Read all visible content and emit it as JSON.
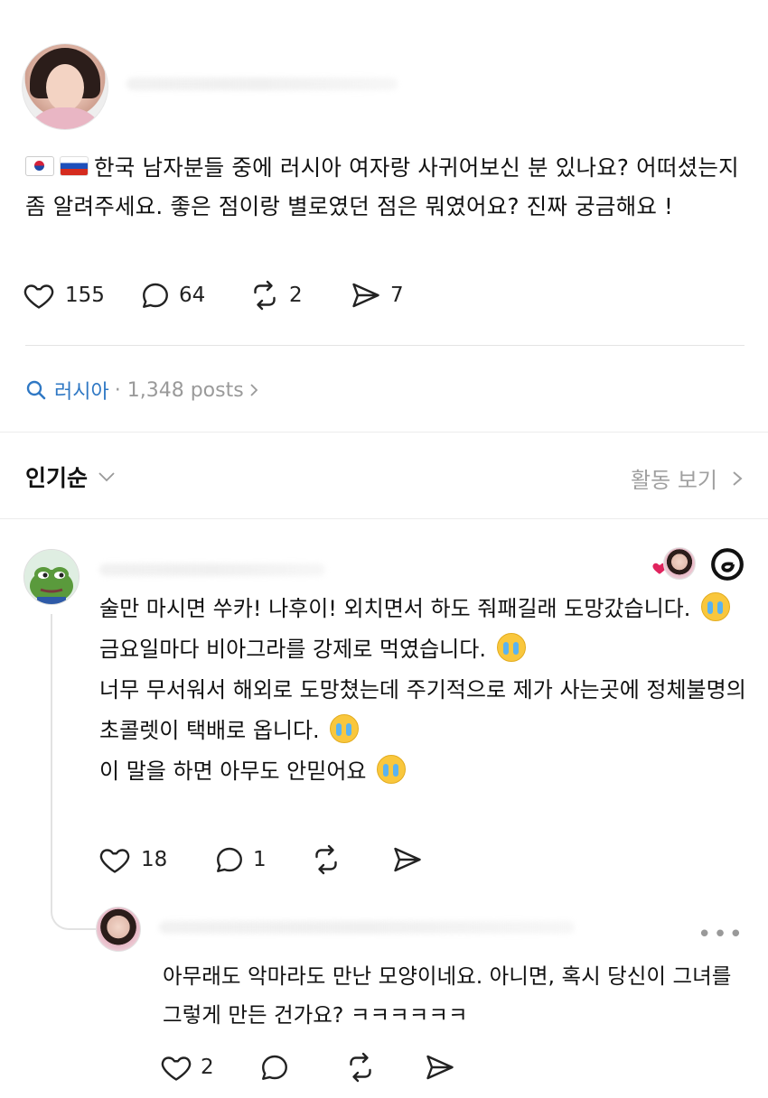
{
  "post": {
    "text": "한국 남자분들 중에 러시아 여자랑 사귀어보신 분 있나요? 어떠셨는지 좀 알려주세요. 좋은 점이랑 별로였던 점은 뭐였어요? 진짜 궁금해요 !",
    "flags": [
      "korea-flag-icon",
      "russia-flag-icon"
    ],
    "likes": "155",
    "comments": "64",
    "reposts": "2",
    "shares": "7"
  },
  "topic": {
    "name": "러시아",
    "count": "· 1,348 posts"
  },
  "sort": {
    "label": "인기순",
    "activity_label": "활동 보기"
  },
  "comment": {
    "lines": [
      "술만 마시면 쑤카! 나후이! 외치면서 하도 줘패길래 도망갔습니다.",
      "금요일마다 비아그라를 강제로 먹였습니다.",
      "너무 무서워서 해외로 도망쳤는데 주기적으로 제가 사는곳에 정체불명의 초콜렛이 택배로 옵니다.",
      "이 말을 하면 아무도 안믿어요"
    ],
    "likes": "18",
    "comments": "1"
  },
  "reply": {
    "text": "아무래도 악마라도 만난 모양이네요. 아니면, 혹시 당신이 그녀를 그렇게 만든 건가요? ㅋㅋㅋㅋㅋㅋ",
    "likes": "2",
    "more": "•••"
  },
  "colors": {
    "link_blue": "#2f78c4",
    "muted_gray": "#9a9a9a",
    "heart_red": "#e0245e"
  }
}
